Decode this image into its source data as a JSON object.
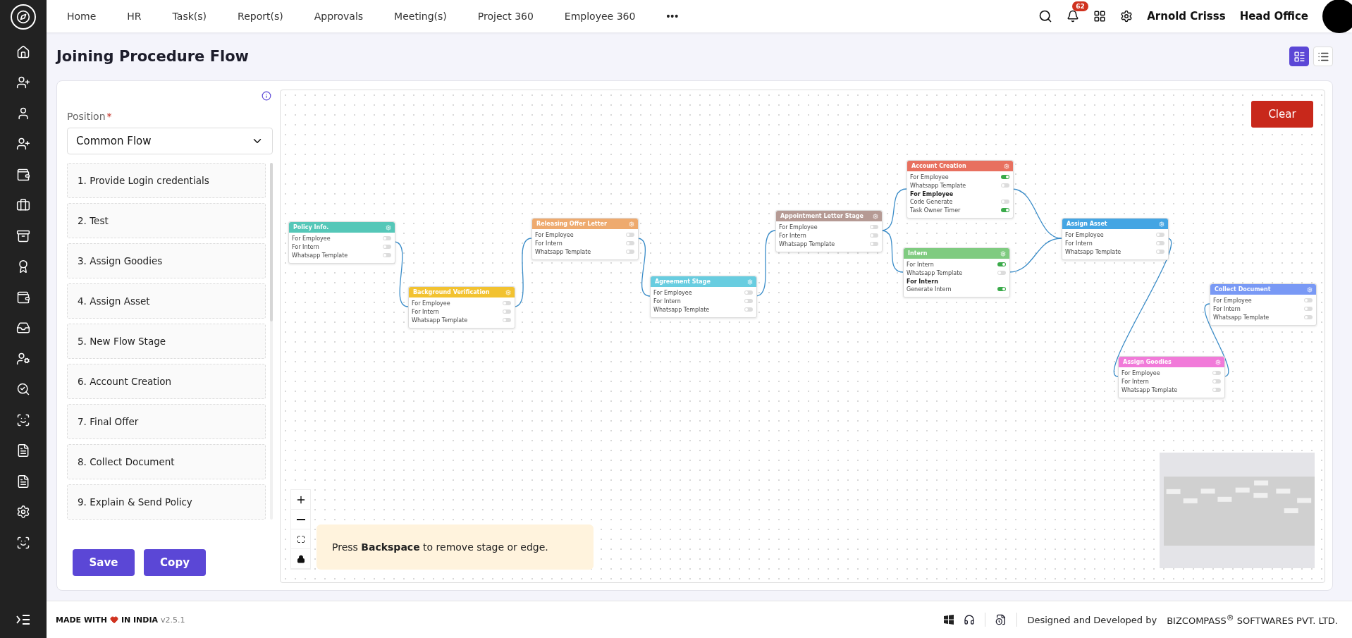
{
  "topbar": {
    "nav": [
      {
        "label": "Home"
      },
      {
        "label": "HR"
      },
      {
        "label": "Task(s)"
      },
      {
        "label": "Report(s)"
      },
      {
        "label": "Approvals"
      },
      {
        "label": "Meeting(s)"
      },
      {
        "label": "Project 360"
      },
      {
        "label": "Employee 360"
      }
    ],
    "more": "•••",
    "notifications": "62",
    "user": "Arnold Crisss",
    "branch": "Head Office"
  },
  "page": {
    "title": "Joining Procedure Flow",
    "views": [
      {
        "kind": "board",
        "selected": true
      },
      {
        "kind": "list",
        "selected": false
      }
    ]
  },
  "panel": {
    "position_label": "Position",
    "required_mark": "*",
    "position_value": "Common Flow",
    "stages": [
      "1. Provide Login credentials",
      "2. Test",
      "3. Assign Goodies",
      "4. Assign Asset",
      "5. New Flow Stage",
      "6. Account Creation",
      "7. Final Offer",
      "8. Collect Document",
      "9. Explain & Send Policy"
    ],
    "buttons": [
      "Save",
      "Copy"
    ]
  },
  "canvas": {
    "clear": "Clear",
    "hint": "Press **Backspace** to remove stage or edge.",
    "nodes": [
      {
        "title": "Policy Info.",
        "color": "#55c7b8",
        "rows": [
          {
            "kind": "toggle",
            "label": "For Employee",
            "on": false
          },
          {
            "kind": "toggle",
            "label": "For Intern",
            "on": false
          },
          {
            "kind": "toggle",
            "label": "Whatsapp Template",
            "on": false
          }
        ]
      },
      {
        "title": "Background Verification",
        "color": "#f2c230",
        "rows": [
          {
            "kind": "toggle",
            "label": "For Employee",
            "on": false
          },
          {
            "kind": "toggle",
            "label": "For Intern",
            "on": false
          },
          {
            "kind": "toggle",
            "label": "Whatsapp Template",
            "on": false
          }
        ]
      },
      {
        "title": "Releasing Offer Letter",
        "color": "#eeaa6e",
        "rows": [
          {
            "kind": "toggle",
            "label": "For Employee",
            "on": false
          },
          {
            "kind": "toggle",
            "label": "For Intern",
            "on": false
          },
          {
            "kind": "toggle",
            "label": "Whatsapp Template",
            "on": false
          }
        ]
      },
      {
        "title": "Agreement Stage",
        "color": "#68cde0",
        "rows": [
          {
            "kind": "toggle",
            "label": "For Employee",
            "on": false
          },
          {
            "kind": "toggle",
            "label": "For Intern",
            "on": false
          },
          {
            "kind": "toggle",
            "label": "Whatsapp Template",
            "on": false
          }
        ]
      },
      {
        "title": "Appointment Letter Stage",
        "color": "#b59a94",
        "rows": [
          {
            "kind": "toggle",
            "label": "For Employee",
            "on": false
          },
          {
            "kind": "toggle",
            "label": "For Intern",
            "on": false
          },
          {
            "kind": "toggle",
            "label": "Whatsapp Template",
            "on": false
          }
        ]
      },
      {
        "title": "Account Creation",
        "color": "#e8705f",
        "rows": [
          {
            "kind": "toggle",
            "label": "For Employee",
            "on": true
          },
          {
            "kind": "toggle",
            "label": "Whatsapp Template",
            "on": false
          },
          {
            "kind": "heading",
            "label": "For Employee"
          },
          {
            "kind": "toggle",
            "label": "Code Generate",
            "on": false
          },
          {
            "kind": "toggle",
            "label": "Task Owner Timer",
            "on": true
          }
        ]
      },
      {
        "title": "Intern",
        "color": "#7fcb80",
        "rows": [
          {
            "kind": "toggle",
            "label": "For Intern",
            "on": true
          },
          {
            "kind": "toggle",
            "label": "Whatsapp Template",
            "on": false
          },
          {
            "kind": "heading",
            "label": "For Intern"
          },
          {
            "kind": "toggle",
            "label": "Generate Intern",
            "on": true
          }
        ]
      },
      {
        "title": "Assign Asset",
        "color": "#44a5e3",
        "rows": [
          {
            "kind": "toggle",
            "label": "For Employee",
            "on": false
          },
          {
            "kind": "toggle",
            "label": "For Intern",
            "on": false
          },
          {
            "kind": "toggle",
            "label": "Whatsapp Template",
            "on": false
          }
        ]
      },
      {
        "title": "Collect Document",
        "color": "#7999f5",
        "rows": [
          {
            "kind": "toggle",
            "label": "For Employee",
            "on": false
          },
          {
            "kind": "toggle",
            "label": "For Intern",
            "on": false
          },
          {
            "kind": "toggle",
            "label": "Whatsapp Template",
            "on": false
          }
        ]
      },
      {
        "title": "Assign Goodies",
        "color": "#f17ad9",
        "rows": [
          {
            "kind": "toggle",
            "label": "For Employee",
            "on": false
          },
          {
            "kind": "toggle",
            "label": "For Intern",
            "on": false
          },
          {
            "kind": "toggle",
            "label": "Whatsapp Template",
            "on": false
          }
        ]
      }
    ]
  },
  "footer": {
    "made_with": "MADE WITH",
    "in_india": "IN INDIA",
    "version": "v2.5.1",
    "credit": "Designed and Developed by",
    "company": "BIZCOMPASS$^{®}$ SOFTWARES PVT. LTD."
  }
}
